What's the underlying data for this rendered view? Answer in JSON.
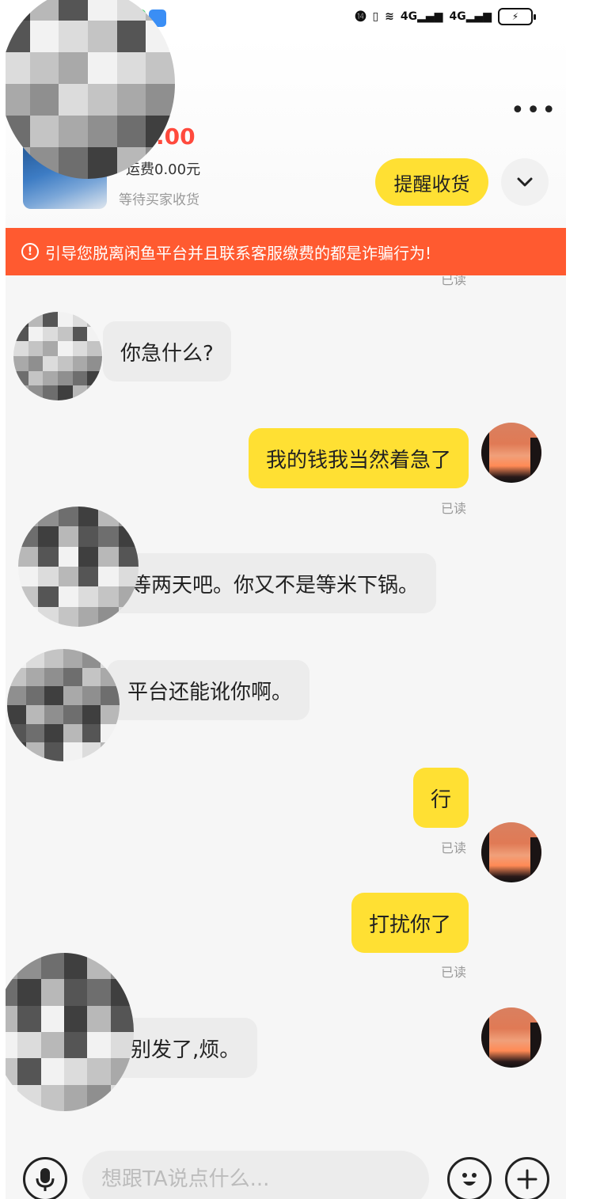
{
  "status_bar": {
    "network_1": "4G",
    "network_2": "4G",
    "app_icon_colors": [
      "#3bd36a",
      "#3a8ef5"
    ]
  },
  "header": {
    "more_icon": "more-horizontal-icon",
    "price_fragment": ".00",
    "shipping_fragment": "运费0.00元",
    "order_status": "等待买家收货",
    "remind_label": "提醒收货",
    "expand_icon": "chevron-down-icon"
  },
  "banner": {
    "icon": "warning-circle-icon",
    "text": "引导您脱离闲鱼平台并且联系客服缴费的都是诈骗行为!"
  },
  "chat": {
    "top_read_label": "已读",
    "messages": [
      {
        "side": "in",
        "text": "你急什么?"
      },
      {
        "side": "out",
        "text": "我的钱我当然着急了",
        "status": "已读"
      },
      {
        "side": "in",
        "text": "等两天吧。你又不是等米下锅。"
      },
      {
        "side": "in",
        "text": "平台还能讹你啊。"
      },
      {
        "side": "out",
        "text": "行",
        "status": "已读"
      },
      {
        "side": "out",
        "text": "打扰你了",
        "status": "已读"
      },
      {
        "side": "in",
        "text": "别发了,烦。"
      }
    ]
  },
  "input_bar": {
    "mic_icon": "microphone-icon",
    "placeholder": "想跟TA说点什么...",
    "emoji_icon": "emoji-icon",
    "plus_icon": "plus-icon"
  },
  "colors": {
    "accent_yellow": "#ffe033",
    "warning_red": "#ff5a30",
    "price_red": "#ff4a3d"
  }
}
